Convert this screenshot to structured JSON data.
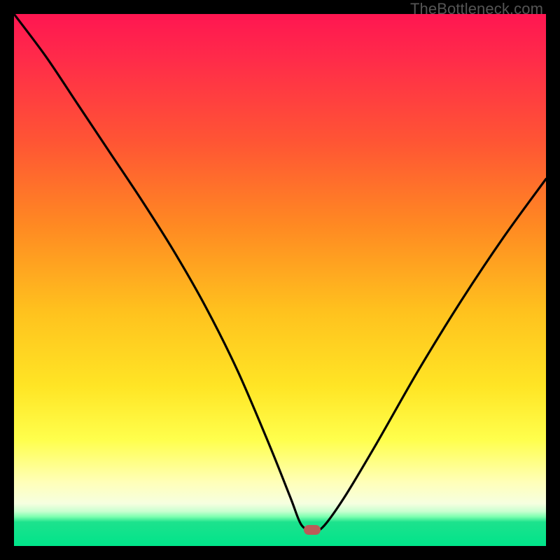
{
  "attribution": "TheBottleneck.com",
  "colors": {
    "bg": "#000000",
    "grad_top": "#ff1651",
    "grad_bottom": "#00e48a",
    "curve": "#000000",
    "marker": "#bb5a58",
    "attribution_text": "#555555"
  },
  "chart_data": {
    "type": "line",
    "title": "",
    "xlabel": "",
    "ylabel": "",
    "xlim": [
      0,
      100
    ],
    "ylim": [
      0,
      100
    ],
    "marker": {
      "x": 56,
      "y": 3
    },
    "x": [
      0,
      6,
      12,
      18,
      24,
      30,
      36,
      42,
      48,
      52,
      54,
      56,
      58,
      62,
      68,
      76,
      84,
      92,
      100
    ],
    "y": [
      100,
      92,
      83,
      74,
      65,
      55.5,
      45,
      33,
      19,
      9,
      4,
      3,
      3.5,
      9,
      19,
      33,
      46,
      58,
      69
    ]
  }
}
